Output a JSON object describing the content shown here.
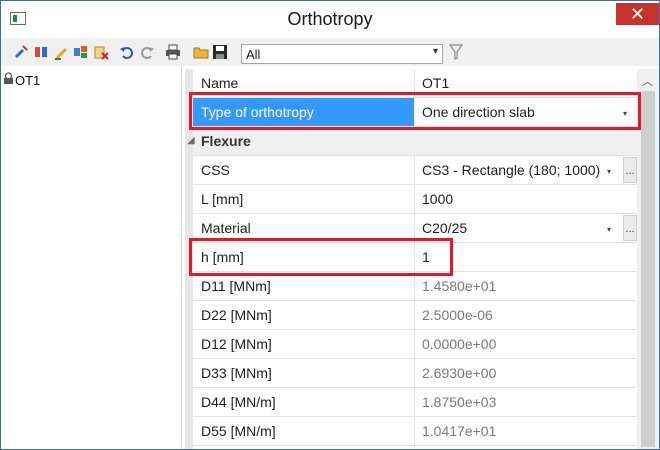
{
  "window": {
    "title": "Orthotropy",
    "close_glyph": "✕"
  },
  "toolbar": {
    "filter_value": "All",
    "combo_arrow": "▾"
  },
  "tree": {
    "items": [
      {
        "label": "OT1"
      }
    ]
  },
  "properties": {
    "rows": [
      {
        "name": "Name",
        "value": "OT1"
      },
      {
        "name": "Type of orthotropy",
        "value": "One direction slab"
      },
      {
        "name": "Flexure",
        "value": ""
      },
      {
        "name": "CSS",
        "value": "CS3 - Rectangle (180; 1000)"
      },
      {
        "name": "L [mm]",
        "value": "1000"
      },
      {
        "name": "Material",
        "value": "C20/25"
      },
      {
        "name": "h [mm]",
        "value": "1"
      },
      {
        "name": "D11 [MNm]",
        "value": "1.4580e+01"
      },
      {
        "name": "D22 [MNm]",
        "value": "2.5000e-06"
      },
      {
        "name": "D12 [MNm]",
        "value": "0.0000e+00"
      },
      {
        "name": "D33 [MNm]",
        "value": "2.6930e+00"
      },
      {
        "name": "D44 [MN/m]",
        "value": "1.8750e+03"
      },
      {
        "name": "D55 [MN/m]",
        "value": "1.0417e+01"
      }
    ],
    "ellipsis": "...",
    "dropdown_arrow": "▾",
    "collapse_glyph": "◢"
  },
  "scrollbar": {
    "up_glyph": "︿"
  },
  "colors": {
    "selection": "#3399ff",
    "highlight": "#e5182a",
    "close": "#c7332c"
  }
}
